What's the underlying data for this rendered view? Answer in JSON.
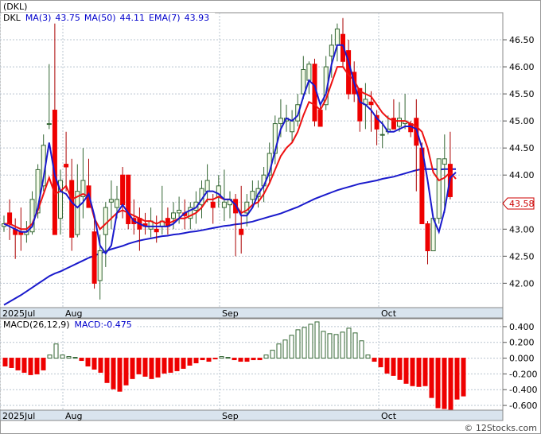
{
  "title": "(DKL)",
  "legend_main": [
    {
      "text": "DKL",
      "color": "#000000"
    },
    {
      "text": "MA(3)",
      "color": "#0000cc"
    },
    {
      "text": "43.75",
      "color": "#0000cc"
    },
    {
      "text": "MA(50)",
      "color": "#0000cc"
    },
    {
      "text": "44.11",
      "color": "#0000cc"
    },
    {
      "text": "EMA(7)",
      "color": "#0000cc"
    },
    {
      "text": "43.93",
      "color": "#0000cc"
    }
  ],
  "legend_macd": [
    {
      "text": "MACD(26,12,9)",
      "color": "#000000"
    },
    {
      "text": "MACD:-0.475",
      "color": "#0000cc"
    }
  ],
  "last_price_label": "43.58",
  "watermark": "© 12Stocks.com",
  "colors": {
    "up_candle": "#f4fbe8",
    "up_outline": "#336633",
    "down_candle": "#ee0000",
    "wick_up": "#336633",
    "wick_down": "#aa0000",
    "ma_blue": "#1a1acc",
    "ema_red": "#ee1111",
    "macd_up": "#336633",
    "macd_down": "#ee0000",
    "grid": "#b9c4cf",
    "axis_band": "#d9e4ee"
  },
  "chart_data": [
    {
      "type": "candlestick",
      "title": "(DKL)",
      "y_ticks": [
        "42.00",
        "42.50",
        "43.00",
        "43.50",
        "44.00",
        "44.50",
        "45.00",
        "45.50",
        "46.00",
        "46.50"
      ],
      "x_ticks": [
        "2025Jul",
        "Aug",
        "Sep",
        "Oct"
      ],
      "ylim": [
        41.55,
        47.0
      ],
      "grid": true,
      "candles": [
        {
          "o": 43.05,
          "h": 43.25,
          "l": 42.95,
          "c": 43.1
        },
        {
          "o": 43.3,
          "h": 43.55,
          "l": 42.8,
          "c": 43.1
        },
        {
          "o": 43.0,
          "h": 43.2,
          "l": 42.45,
          "c": 42.9
        },
        {
          "o": 42.95,
          "h": 43.4,
          "l": 42.6,
          "c": 42.9
        },
        {
          "o": 42.9,
          "h": 43.15,
          "l": 42.75,
          "c": 42.95
        },
        {
          "o": 42.95,
          "h": 43.7,
          "l": 42.9,
          "c": 43.55
        },
        {
          "o": 43.3,
          "h": 44.2,
          "l": 43.2,
          "c": 44.1
        },
        {
          "o": 43.8,
          "h": 44.75,
          "l": 43.7,
          "c": 44.55
        },
        {
          "o": 44.95,
          "h": 46.05,
          "l": 44.85,
          "c": 44.95
        },
        {
          "o": 45.2,
          "h": 46.8,
          "l": 43.1,
          "c": 42.9
        },
        {
          "o": 43.2,
          "h": 44.1,
          "l": 42.9,
          "c": 43.9
        },
        {
          "o": 44.2,
          "h": 44.8,
          "l": 43.7,
          "c": 44.15
        },
        {
          "o": 43.9,
          "h": 44.3,
          "l": 42.6,
          "c": 42.85
        },
        {
          "o": 42.9,
          "h": 44.2,
          "l": 42.85,
          "c": 43.7
        },
        {
          "o": 43.6,
          "h": 44.5,
          "l": 43.2,
          "c": 43.9
        },
        {
          "o": 43.8,
          "h": 44.3,
          "l": 43.4,
          "c": 43.4
        },
        {
          "o": 42.95,
          "h": 43.2,
          "l": 41.9,
          "c": 42.0
        },
        {
          "o": 42.05,
          "h": 42.9,
          "l": 41.7,
          "c": 42.6
        },
        {
          "o": 42.9,
          "h": 43.5,
          "l": 42.3,
          "c": 43.4
        },
        {
          "o": 43.5,
          "h": 43.9,
          "l": 43.0,
          "c": 43.55
        },
        {
          "o": 43.4,
          "h": 43.8,
          "l": 43.2,
          "c": 43.55
        },
        {
          "o": 44.0,
          "h": 44.15,
          "l": 43.2,
          "c": 43.45
        },
        {
          "o": 44.0,
          "h": 44.0,
          "l": 43.0,
          "c": 43.1
        },
        {
          "o": 43.2,
          "h": 43.55,
          "l": 42.9,
          "c": 43.1
        },
        {
          "o": 43.2,
          "h": 43.4,
          "l": 42.6,
          "c": 43.0
        },
        {
          "o": 43.1,
          "h": 43.3,
          "l": 42.9,
          "c": 43.05
        },
        {
          "o": 43.0,
          "h": 43.4,
          "l": 42.85,
          "c": 43.15
        },
        {
          "o": 43.0,
          "h": 43.25,
          "l": 42.75,
          "c": 42.95
        },
        {
          "o": 43.05,
          "h": 43.8,
          "l": 42.9,
          "c": 43.15
        },
        {
          "o": 43.2,
          "h": 43.4,
          "l": 42.9,
          "c": 43.05
        },
        {
          "o": 43.2,
          "h": 43.5,
          "l": 43.0,
          "c": 43.3
        },
        {
          "o": 43.3,
          "h": 43.6,
          "l": 43.1,
          "c": 43.35
        },
        {
          "o": 43.3,
          "h": 43.55,
          "l": 43.0,
          "c": 43.25
        },
        {
          "o": 43.2,
          "h": 43.5,
          "l": 43.0,
          "c": 43.4
        },
        {
          "o": 43.35,
          "h": 43.7,
          "l": 43.1,
          "c": 43.5
        },
        {
          "o": 43.45,
          "h": 43.9,
          "l": 43.2,
          "c": 43.75
        },
        {
          "o": 43.7,
          "h": 44.2,
          "l": 43.5,
          "c": 43.9
        },
        {
          "o": 43.5,
          "h": 43.65,
          "l": 43.1,
          "c": 43.4
        },
        {
          "o": 43.6,
          "h": 44.0,
          "l": 43.4,
          "c": 43.8
        },
        {
          "o": 43.4,
          "h": 44.1,
          "l": 43.15,
          "c": 43.5
        },
        {
          "o": 43.45,
          "h": 43.7,
          "l": 43.2,
          "c": 43.55
        },
        {
          "o": 43.55,
          "h": 43.65,
          "l": 42.5,
          "c": 43.3
        },
        {
          "o": 43.0,
          "h": 43.8,
          "l": 42.55,
          "c": 42.9
        },
        {
          "o": 43.3,
          "h": 43.65,
          "l": 43.05,
          "c": 43.5
        },
        {
          "o": 43.55,
          "h": 43.9,
          "l": 43.4,
          "c": 43.7
        },
        {
          "o": 43.6,
          "h": 43.9,
          "l": 43.4,
          "c": 43.75
        },
        {
          "o": 43.8,
          "h": 44.15,
          "l": 43.5,
          "c": 44.0
        },
        {
          "o": 44.0,
          "h": 44.6,
          "l": 43.85,
          "c": 44.4
        },
        {
          "o": 44.4,
          "h": 45.1,
          "l": 44.2,
          "c": 44.95
        },
        {
          "o": 44.95,
          "h": 45.4,
          "l": 44.7,
          "c": 45.05
        },
        {
          "o": 45.0,
          "h": 45.3,
          "l": 44.8,
          "c": 45.05
        },
        {
          "o": 44.8,
          "h": 45.2,
          "l": 44.6,
          "c": 45.0
        },
        {
          "o": 45.0,
          "h": 45.5,
          "l": 44.9,
          "c": 45.3
        },
        {
          "o": 45.5,
          "h": 46.2,
          "l": 45.4,
          "c": 45.95
        },
        {
          "o": 45.75,
          "h": 46.1,
          "l": 45.5,
          "c": 46.05
        },
        {
          "o": 46.05,
          "h": 46.15,
          "l": 44.9,
          "c": 45.0
        },
        {
          "o": 45.2,
          "h": 45.3,
          "l": 44.9,
          "c": 44.9
        },
        {
          "o": 45.3,
          "h": 46.2,
          "l": 45.2,
          "c": 46.0
        },
        {
          "o": 46.2,
          "h": 46.6,
          "l": 45.8,
          "c": 46.4
        },
        {
          "o": 46.4,
          "h": 46.8,
          "l": 46.1,
          "c": 46.7
        },
        {
          "o": 46.6,
          "h": 46.9,
          "l": 46.0,
          "c": 46.1
        },
        {
          "o": 46.3,
          "h": 46.5,
          "l": 45.4,
          "c": 45.5
        },
        {
          "o": 45.9,
          "h": 46.1,
          "l": 45.35,
          "c": 45.5
        },
        {
          "o": 45.6,
          "h": 45.6,
          "l": 44.8,
          "c": 45.0
        },
        {
          "o": 45.3,
          "h": 45.7,
          "l": 44.85,
          "c": 45.4
        },
        {
          "o": 45.35,
          "h": 45.55,
          "l": 44.8,
          "c": 45.3
        },
        {
          "o": 45.1,
          "h": 45.2,
          "l": 44.55,
          "c": 44.85
        },
        {
          "o": 44.75,
          "h": 45.0,
          "l": 44.5,
          "c": 44.75
        },
        {
          "o": 44.8,
          "h": 45.1,
          "l": 44.75,
          "c": 44.85
        },
        {
          "o": 45.05,
          "h": 45.4,
          "l": 44.9,
          "c": 44.85
        },
        {
          "o": 44.9,
          "h": 45.35,
          "l": 44.8,
          "c": 45.05
        },
        {
          "o": 44.95,
          "h": 45.5,
          "l": 44.85,
          "c": 45.0
        },
        {
          "o": 44.95,
          "h": 45.0,
          "l": 44.7,
          "c": 44.8
        },
        {
          "o": 45.05,
          "h": 45.4,
          "l": 43.7,
          "c": 44.55
        },
        {
          "o": 44.5,
          "h": 44.6,
          "l": 43.1,
          "c": 43.1
        },
        {
          "o": 43.1,
          "h": 43.15,
          "l": 42.35,
          "c": 42.6
        },
        {
          "o": 42.6,
          "h": 43.2,
          "l": 42.6,
          "c": 43.2
        },
        {
          "o": 43.2,
          "h": 44.3,
          "l": 43.1,
          "c": 44.3
        },
        {
          "o": 44.2,
          "h": 44.75,
          "l": 43.3,
          "c": 44.3
        },
        {
          "o": 44.2,
          "h": 44.8,
          "l": 43.55,
          "c": 43.6
        }
      ],
      "series": [
        {
          "name": "MA(50)",
          "values": [
            41.6,
            41.66,
            41.72,
            41.78,
            41.85,
            41.92,
            41.99,
            42.06,
            42.13,
            42.18,
            42.22,
            42.27,
            42.32,
            42.37,
            42.42,
            42.47,
            42.51,
            42.55,
            42.59,
            42.63,
            42.66,
            42.69,
            42.73,
            42.76,
            42.79,
            42.81,
            42.83,
            42.85,
            42.87,
            42.88,
            42.9,
            42.91,
            42.93,
            42.95,
            42.96,
            42.98,
            43.0,
            43.02,
            43.04,
            43.06,
            43.07,
            43.09,
            43.1,
            43.12,
            43.14,
            43.17,
            43.2,
            43.23,
            43.26,
            43.29,
            43.33,
            43.37,
            43.41,
            43.46,
            43.51,
            43.56,
            43.6,
            43.64,
            43.68,
            43.72,
            43.75,
            43.78,
            43.81,
            43.84,
            43.86,
            43.88,
            43.9,
            43.93,
            43.95,
            43.97,
            44.0,
            44.03,
            44.06,
            44.09,
            44.11,
            44.11,
            44.11,
            44.1,
            44.11,
            44.11,
            44.11
          ]
        },
        {
          "name": "MA(3)",
          "values": [
            43.1,
            43.05,
            43.0,
            42.95,
            42.95,
            43.05,
            43.4,
            43.95,
            44.6,
            44.0,
            43.7,
            43.65,
            43.5,
            43.4,
            43.5,
            43.65,
            43.25,
            42.7,
            42.55,
            42.7,
            43.3,
            43.45,
            43.3,
            43.15,
            43.1,
            43.05,
            43.05,
            43.05,
            43.05,
            43.05,
            43.1,
            43.2,
            43.3,
            43.35,
            43.4,
            43.55,
            43.7,
            43.7,
            43.65,
            43.55,
            43.55,
            43.45,
            43.25,
            43.25,
            43.4,
            43.65,
            43.8,
            44.05,
            44.45,
            44.85,
            45.05,
            45.0,
            45.1,
            45.45,
            45.75,
            45.65,
            45.3,
            45.5,
            46.05,
            46.4,
            46.4,
            46.1,
            45.7,
            45.35,
            45.3,
            45.2,
            45.05,
            44.95,
            44.8,
            44.8,
            44.85,
            44.9,
            44.9,
            44.85,
            44.5,
            43.9,
            43.2,
            42.95,
            43.35,
            43.95,
            44.05
          ]
        },
        {
          "name": "EMA(7)",
          "values": [
            43.1,
            43.1,
            43.05,
            43.0,
            43.0,
            43.1,
            43.35,
            43.65,
            43.95,
            43.65,
            43.7,
            43.8,
            43.55,
            43.6,
            43.65,
            43.6,
            43.2,
            43.0,
            43.1,
            43.2,
            43.3,
            43.35,
            43.3,
            43.25,
            43.2,
            43.15,
            43.15,
            43.1,
            43.15,
            43.1,
            43.15,
            43.2,
            43.2,
            43.25,
            43.3,
            43.4,
            43.55,
            43.55,
            43.6,
            43.55,
            43.55,
            43.45,
            43.3,
            43.35,
            43.45,
            43.5,
            43.65,
            43.85,
            44.1,
            44.35,
            44.5,
            44.6,
            44.8,
            45.1,
            45.35,
            45.3,
            45.2,
            45.4,
            45.7,
            46.0,
            46.0,
            45.85,
            45.75,
            45.55,
            45.5,
            45.45,
            45.3,
            45.15,
            45.05,
            45.0,
            45.0,
            45.0,
            44.95,
            44.9,
            44.8,
            44.5,
            44.05,
            43.9,
            43.95,
            44.05,
            43.93
          ]
        }
      ]
    },
    {
      "type": "bar",
      "title": "MACD(26,12,9)",
      "y_ticks": [
        "0.400",
        "0.200",
        "0.000",
        "-0.200",
        "-0.400",
        "-0.600"
      ],
      "x_ticks": [
        "2025Jul",
        "Aug",
        "Sep",
        "Oct"
      ],
      "ylim": [
        -0.66,
        0.5
      ],
      "values": [
        -0.1,
        -0.12,
        -0.15,
        -0.18,
        -0.21,
        -0.2,
        -0.15,
        0.04,
        0.18,
        0.04,
        0.02,
        0.01,
        -0.03,
        -0.1,
        -0.14,
        -0.18,
        -0.31,
        -0.39,
        -0.42,
        -0.34,
        -0.26,
        -0.2,
        -0.23,
        -0.26,
        -0.24,
        -0.19,
        -0.18,
        -0.16,
        -0.13,
        -0.09,
        -0.06,
        -0.02,
        -0.04,
        -0.01,
        0.02,
        0.01,
        -0.02,
        -0.04,
        -0.04,
        -0.02,
        -0.02,
        0.04,
        0.1,
        0.18,
        0.23,
        0.29,
        0.36,
        0.39,
        0.43,
        0.46,
        0.34,
        0.31,
        0.3,
        0.33,
        0.38,
        0.32,
        0.22,
        0.04,
        -0.04,
        -0.11,
        -0.19,
        -0.22,
        -0.27,
        -0.32,
        -0.35,
        -0.36,
        -0.35,
        -0.5,
        -0.63,
        -0.64,
        -0.65,
        -0.52,
        -0.48
      ]
    }
  ]
}
